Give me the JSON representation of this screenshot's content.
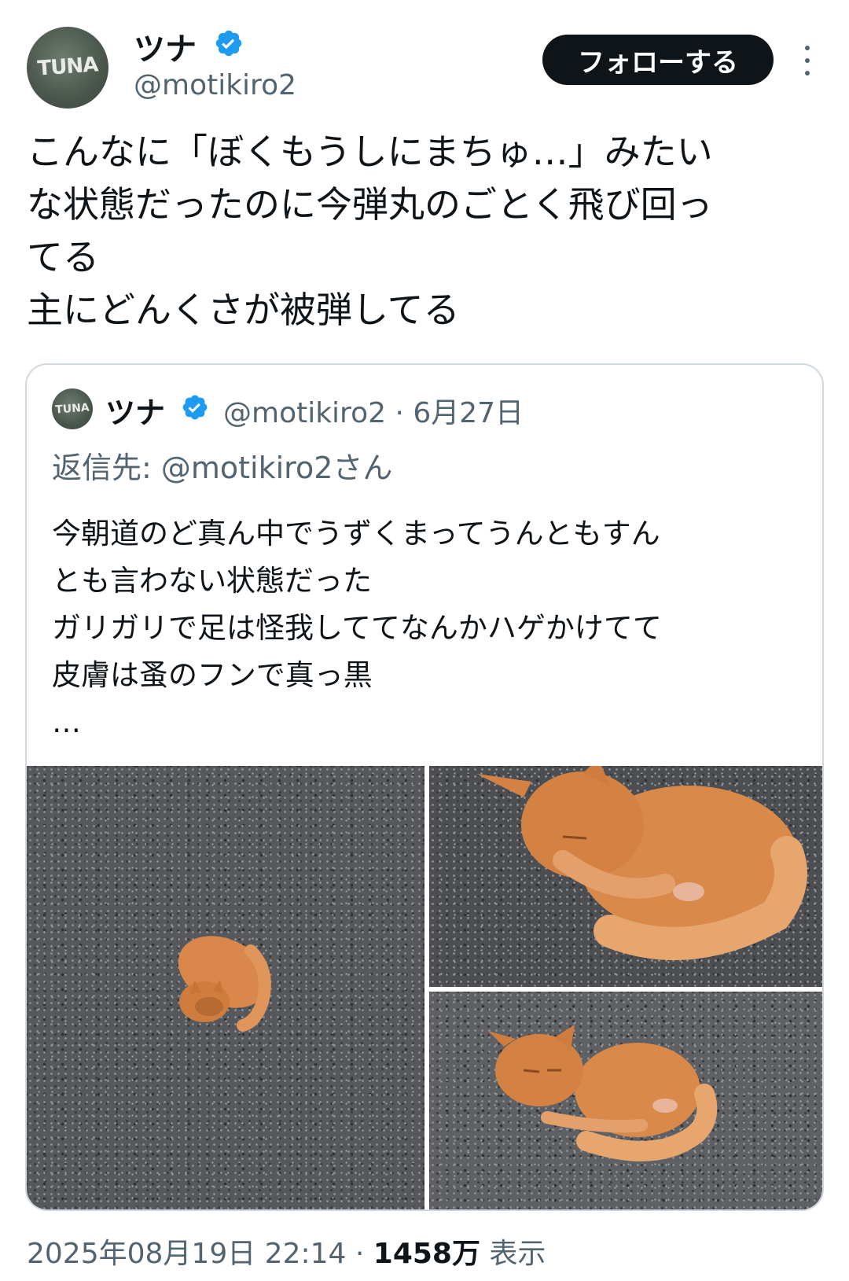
{
  "author": {
    "display_name": "ツナ",
    "handle": "@motikiro2",
    "avatar_text": "TUNA",
    "verified": true
  },
  "follow_label": "フォローする",
  "tweet_lines": [
    "こんなに「ぼくもうしにまちゅ…」みたい",
    "な状態だったのに今弾丸のごとく飛び回っ",
    "てる",
    "主にどんくさが被弾してる"
  ],
  "quote": {
    "display_name": "ツナ",
    "avatar_text": "TUNA",
    "meta": "@motikiro2 · 6月27日",
    "reply_to": "返信先: @motikiro2さん",
    "lines": [
      "今朝道のど真ん中でうずくまってうんともすん",
      "とも言わない状態だった",
      "ガリガリで足は怪我しててなんかハゲかけてて",
      "皮膚は蚤のフンで真っ黒",
      "…"
    ]
  },
  "footer": {
    "timestamp": "2025年08月19日 22:14",
    "separator": " · ",
    "views": "1458万",
    "views_label": " 表示"
  },
  "colors": {
    "text": "#0f1419",
    "secondary": "#536471",
    "verified_blue": "#1d9bf0",
    "border": "#cfd9de",
    "cat_orange": "#d98a4a"
  }
}
